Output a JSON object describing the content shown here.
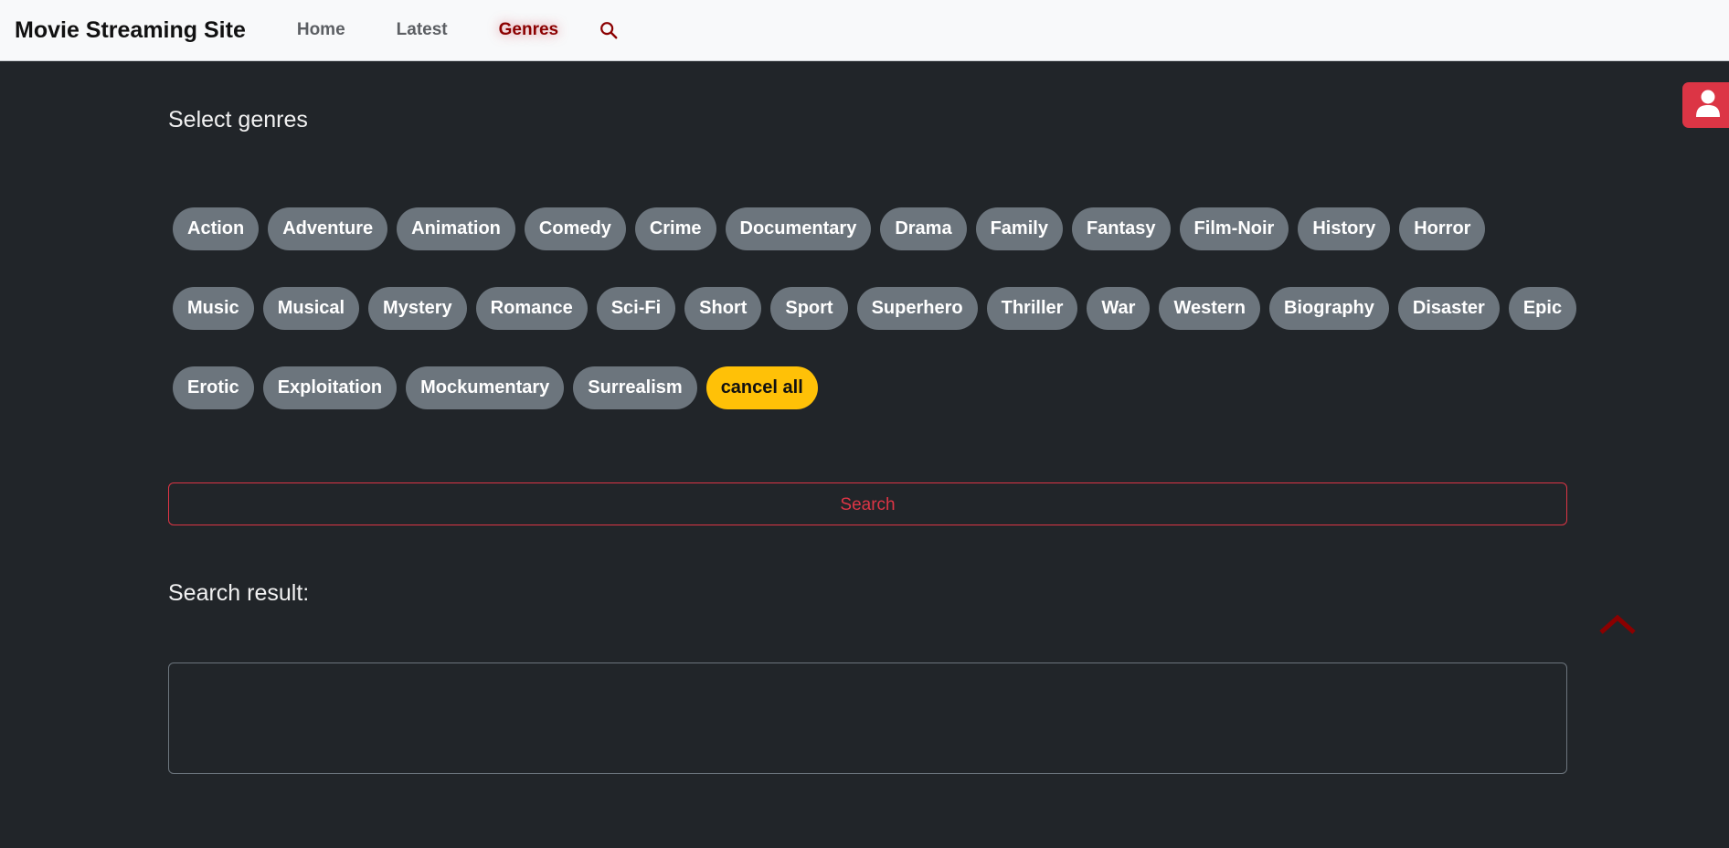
{
  "navbar": {
    "brand": "Movie Streaming Site",
    "links": [
      {
        "label": "Home",
        "active": false
      },
      {
        "label": "Latest",
        "active": false
      },
      {
        "label": "Genres",
        "active": true
      }
    ],
    "search_icon": "search-icon",
    "active_color": "#8b0000"
  },
  "user_button": {
    "icon": "user-icon",
    "color": "#dc3545"
  },
  "genres": {
    "title": "Select genres",
    "row1": [
      "Action",
      "Adventure",
      "Animation",
      "Comedy",
      "Crime",
      "Documentary",
      "Drama",
      "Family",
      "Fantasy",
      "Film-Noir",
      "History",
      "Horror"
    ],
    "row2": [
      "Music",
      "Musical",
      "Mystery",
      "Romance",
      "Sci-Fi",
      "Short",
      "Sport",
      "Superhero",
      "Thriller",
      "War",
      "Western",
      "Biography",
      "Disaster",
      "Epic"
    ],
    "row3": [
      "Erotic",
      "Exploitation",
      "Mockumentary",
      "Surrealism"
    ],
    "cancel_label": "cancel all",
    "chip_color": "#6c757d",
    "cancel_color": "#ffc107"
  },
  "search": {
    "button_label": "Search",
    "color": "#dc3545"
  },
  "results": {
    "title": "Search result:"
  },
  "scroll_top": {
    "icon": "chevron-up-icon",
    "color": "#8b0000"
  }
}
